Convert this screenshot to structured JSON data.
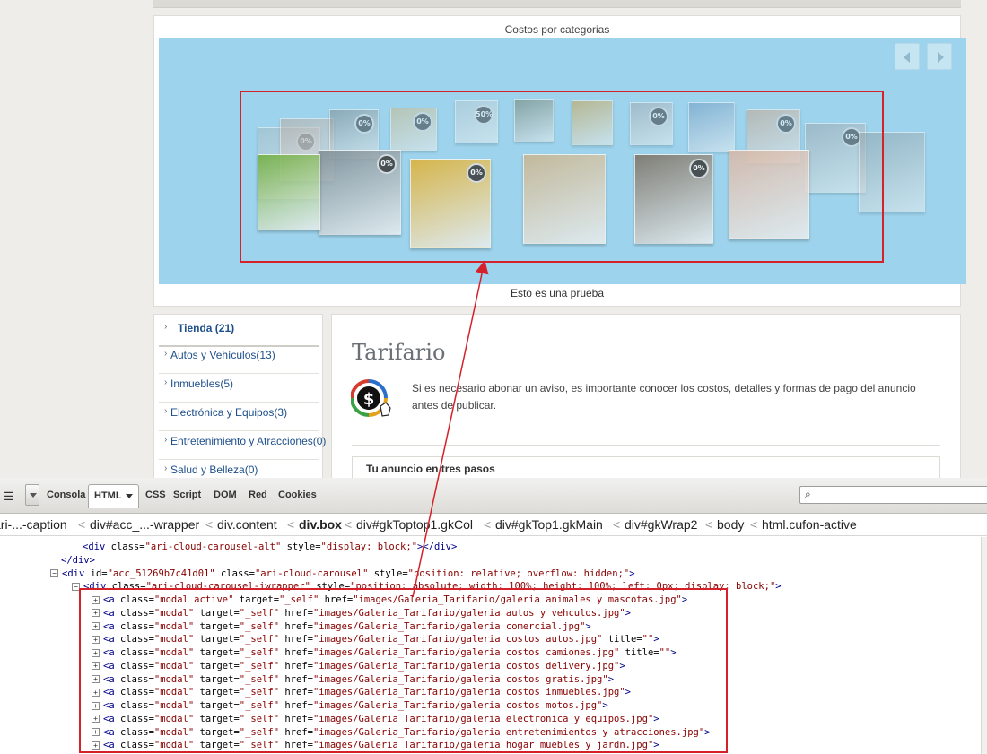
{
  "site": {
    "breadcrumb": "",
    "gallery_title": "Costos por categorias",
    "gallery_caption": "Esto es una prueba",
    "carousel_badges": [
      "0%",
      "0%",
      "0%",
      "50%",
      "0%",
      "0%",
      "0%",
      "0%",
      "0%",
      "0%"
    ],
    "sidebar": {
      "items": [
        {
          "label": "Tienda (21)",
          "active": true
        },
        {
          "label": "Autos y Vehículos(13)"
        },
        {
          "label": "Inmuebles(5)"
        },
        {
          "label": "Electrónica y Equipos(3)"
        },
        {
          "label": "Entretenimiento y Atracciones(0)"
        },
        {
          "label": "Salud y Belleza(0)"
        }
      ]
    },
    "main": {
      "title": "Tarifario",
      "intro": "Si es necesario abonar un aviso, es importante conocer los costos, detalles y formas de pago del anuncio antes de publicar.",
      "steps_title": "Tu anuncio en tres pasos"
    }
  },
  "firebug": {
    "tabs": [
      "Consola",
      "HTML",
      "CSS",
      "Script",
      "DOM",
      "Red",
      "Cookies"
    ],
    "active_tab": "HTML",
    "breadcrumbs": [
      "ari-...-caption",
      "div#acc_...-wrapper",
      "div.content",
      "div.box",
      "div#gkToptop1.gkCol",
      "div#gkTop1.gkMain",
      "div#gkWrap2",
      "body",
      "html.cufon-active"
    ],
    "selected_crumb": "div.box",
    "code_lines": [
      {
        "indent": 92,
        "kind": "plain",
        "text": "<div class=\"ari-cloud-carousel-alt\" style=\"display: block;\"></div>"
      },
      {
        "indent": 68,
        "kind": "plain",
        "text": "</div>"
      },
      {
        "indent": 56,
        "kind": "open",
        "text": "<div id=\"acc_51269b7c41d01\" class=\"ari-cloud-carousel\" style=\"position: relative; overflow: hidden;\">"
      },
      {
        "indent": 80,
        "kind": "open",
        "text": "<div class=\"ari-cloud-carousel-iwrapper\" style=\"position: absolute; width: 100%; height: 100%; left: 0px; display: block;\">"
      },
      {
        "indent": 102,
        "kind": "closed",
        "text": "<a class=\"modal active\" target=\"_self\" href=\"images/Galeria_Tarifario/galeria animales y mascotas.jpg\">"
      },
      {
        "indent": 102,
        "kind": "closed",
        "text": "<a class=\"modal\" target=\"_self\" href=\"images/Galeria_Tarifario/galeria autos y vehculos.jpg\">"
      },
      {
        "indent": 102,
        "kind": "closed",
        "text": "<a class=\"modal\" target=\"_self\" href=\"images/Galeria_Tarifario/galeria comercial.jpg\">"
      },
      {
        "indent": 102,
        "kind": "closed",
        "text": "<a class=\"modal\" target=\"_self\" href=\"images/Galeria_Tarifario/galeria costos autos.jpg\" title=\"\">"
      },
      {
        "indent": 102,
        "kind": "closed",
        "text": "<a class=\"modal\" target=\"_self\" href=\"images/Galeria_Tarifario/galeria costos camiones.jpg\" title=\"\">"
      },
      {
        "indent": 102,
        "kind": "closed",
        "text": "<a class=\"modal\" target=\"_self\" href=\"images/Galeria_Tarifario/galeria costos delivery.jpg\">"
      },
      {
        "indent": 102,
        "kind": "closed",
        "text": "<a class=\"modal\" target=\"_self\" href=\"images/Galeria_Tarifario/galeria costos gratis.jpg\">"
      },
      {
        "indent": 102,
        "kind": "closed",
        "text": "<a class=\"modal\" target=\"_self\" href=\"images/Galeria_Tarifario/galeria costos inmuebles.jpg\">"
      },
      {
        "indent": 102,
        "kind": "closed",
        "text": "<a class=\"modal\" target=\"_self\" href=\"images/Galeria_Tarifario/galeria costos motos.jpg\">"
      },
      {
        "indent": 102,
        "kind": "closed",
        "text": "<a class=\"modal\" target=\"_self\" href=\"images/Galeria_Tarifario/galeria electronica y equipos.jpg\">"
      },
      {
        "indent": 102,
        "kind": "closed",
        "text": "<a class=\"modal\" target=\"_self\" href=\"images/Galeria_Tarifario/galeria entretenimientos y atracciones.jpg\">"
      },
      {
        "indent": 102,
        "kind": "closed",
        "text": "<a class=\"modal\" target=\"_self\" href=\"images/Galeria_Tarifario/galeria hogar muebles y jardn.jpg\">"
      }
    ]
  },
  "colors": {
    "carousel_bg": "#9dd3ec",
    "highlight_red": "#d4212a",
    "link_blue": "#1e4f8a",
    "tag_blue": "#000088",
    "value_red": "#880000"
  }
}
